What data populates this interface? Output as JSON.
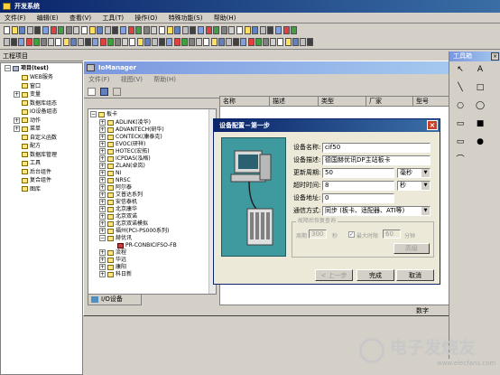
{
  "app": {
    "title": "开发系统"
  },
  "menu": [
    "文件(F)",
    "编辑(E)",
    "查看(V)",
    "工具(T)",
    "操作(O)",
    "特殊功能(S)",
    "帮助(H)"
  ],
  "project": {
    "title": "工程项目",
    "root": "项目(test)",
    "items": [
      "WEB服务",
      "窗口",
      "变量",
      "数据库组态",
      "IO设备组态",
      "动作",
      "菜单",
      "自定义函数",
      "配方",
      "数据库管理",
      "工具",
      "后台组件",
      "复合组件",
      "图库"
    ]
  },
  "iomanager": {
    "title": "IoManager",
    "menu": [
      "文件(F)",
      "视图(V)",
      "帮助(H)"
    ],
    "tree_root": "板卡",
    "tree": [
      "ADLINK(凌华)",
      "ADVANTECH(研华)",
      "CONTECK(康泰克)",
      "EVOC(研祥)",
      "HOTEC(宏拓)",
      "ICPDAS(泓格)",
      "ZLAN(卓岚)",
      "NI",
      "NRSC",
      "阿尔泰",
      "艾普达系列",
      "安信泰机",
      "北京康华",
      "北京双诺",
      "北京双诺模拟",
      "福州(PCI-PS000系列)",
      "赫优讯"
    ],
    "tree_child": "PR-CONBICIFSO-FB",
    "tree_after": [
      "流程",
      "华远",
      "康阳",
      "科日新"
    ],
    "tab": "I/O设备",
    "columns": [
      "名称",
      "描述",
      "类型",
      "厂家",
      "型号"
    ],
    "status": "数字"
  },
  "toolbox": {
    "title": "工具箱"
  },
  "dialog": {
    "title": "设备配置－第一步",
    "labels": {
      "device_name": "设备名称:",
      "device_desc": "设备描述:",
      "update_period": "更新周期:",
      "timeout": "超时时间:",
      "address": "设备地址:",
      "comm": "通信方式:"
    },
    "values": {
      "device_name": "cif50",
      "device_desc": "德国赫优讯DP主站板卡",
      "update_period": "50",
      "update_unit": "毫秒",
      "timeout": "8",
      "timeout_unit": "秒",
      "address": "0",
      "comm": "同步 (板卡、适配器、ATI等)"
    },
    "group_title": "故障后恢复查询",
    "group_labels": {
      "period": "周期",
      "period_val": "300",
      "sec": "秒",
      "max_label": "最大时限",
      "max_val": "60",
      "min": "分钟"
    },
    "buttons": {
      "advanced": "高级",
      "prev": "上一步",
      "finish": "完成",
      "cancel": "取消"
    }
  },
  "watermark": {
    "brand": "电子发烧友",
    "url": "www.elecfans.com"
  },
  "colors": {
    "titlebar": "#0a246a",
    "dialog_bg": "#ece9d8",
    "illus_bg": "#3f9aa0",
    "watermark": "#c8c8c8"
  }
}
